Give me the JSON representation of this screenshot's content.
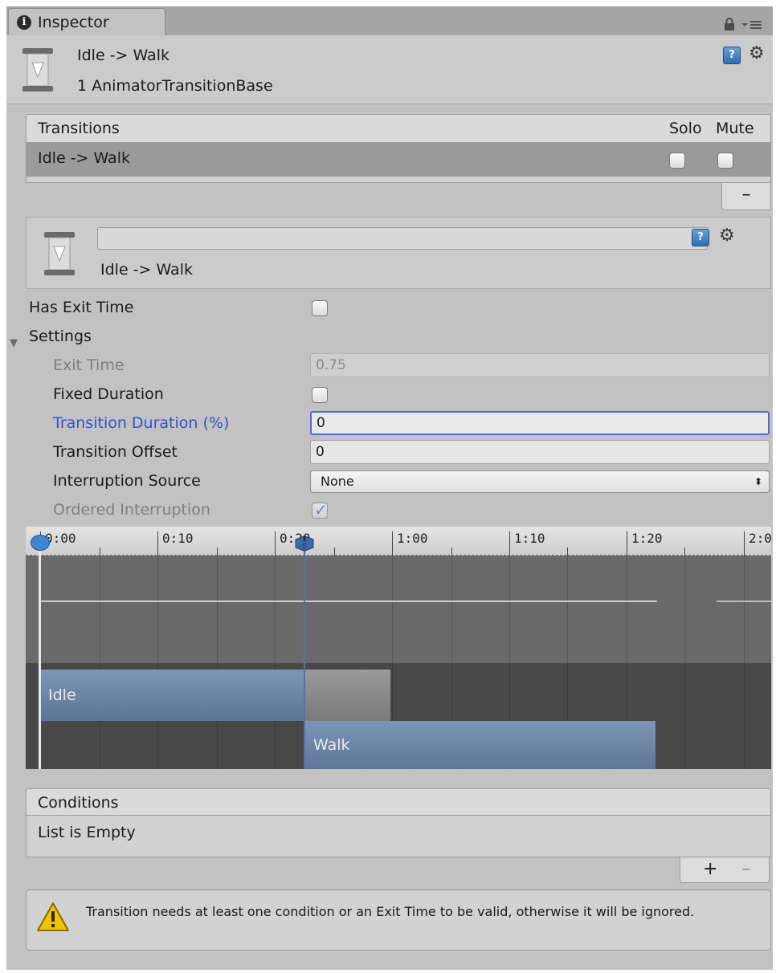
{
  "tab": {
    "title": "Inspector"
  },
  "header": {
    "title": "Idle -> Walk",
    "subtitle": "1 AnimatorTransitionBase"
  },
  "transitions_list": {
    "header": "Transitions",
    "solo_label": "Solo",
    "mute_label": "Mute",
    "rows": [
      {
        "label": "Idle -> Walk",
        "solo": false,
        "mute": false
      }
    ],
    "remove_label": "–"
  },
  "transition_detail": {
    "name_value": "",
    "label": "Idle -> Walk"
  },
  "properties": {
    "has_exit_time": {
      "label": "Has Exit Time",
      "checked": false
    },
    "settings_label": "Settings",
    "exit_time": {
      "label": "Exit Time",
      "value": "0.75"
    },
    "fixed_duration": {
      "label": "Fixed Duration",
      "checked": false
    },
    "transition_duration": {
      "label": "Transition Duration (%)",
      "value": "0"
    },
    "transition_offset": {
      "label": "Transition Offset",
      "value": "0"
    },
    "interruption_source": {
      "label": "Interruption Source",
      "value": "None"
    },
    "ordered_interruption": {
      "label": "Ordered Interruption",
      "checked": true
    }
  },
  "timeline": {
    "ticks": [
      "0:00",
      "0:10",
      "0:20",
      "1:00",
      "1:10",
      "1:20",
      "2:0"
    ],
    "clips": {
      "source": "Idle",
      "destination": "Walk"
    }
  },
  "conditions": {
    "header": "Conditions",
    "empty_text": "List is Empty",
    "add_label": "+",
    "remove_label": "–"
  },
  "warning": {
    "text": "Transition needs at least one condition or an Exit Time to be valid, otherwise it will be ignored."
  },
  "colors": {
    "panel": "#c2c2c2",
    "focus_blue": "#3552c8",
    "clip_blue": "#6b84a6",
    "selected_row": "#9a9a9a"
  },
  "icons": {
    "tab": "info-icon",
    "lock": "lock-icon",
    "menu": "panel-menu-icon",
    "transition": "transition-icon",
    "help": "help-icon",
    "settings": "gear-icon",
    "warning": "warning-icon"
  }
}
